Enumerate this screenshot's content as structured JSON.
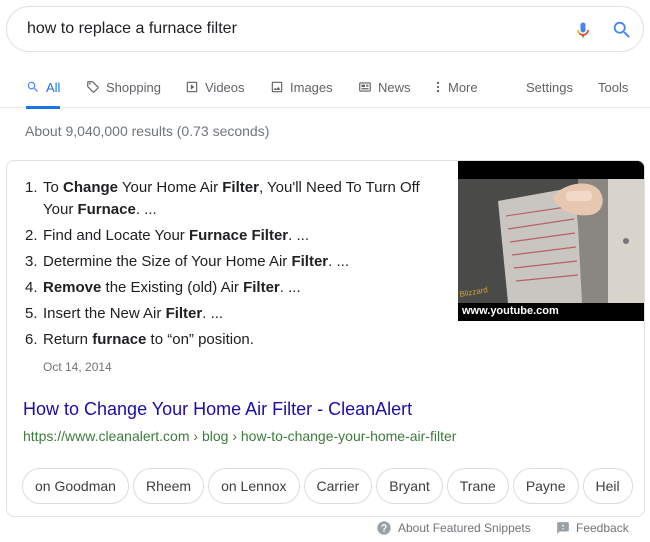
{
  "search": {
    "query": "how to replace a furnace filter"
  },
  "tabs": [
    {
      "label": "All",
      "active": true
    },
    {
      "label": "Shopping"
    },
    {
      "label": "Videos"
    },
    {
      "label": "Images"
    },
    {
      "label": "News"
    },
    {
      "label": "More"
    }
  ],
  "tools": {
    "settings": "Settings",
    "tools": "Tools"
  },
  "stats": "About 9,040,000 results (0.73 seconds)",
  "snippet": {
    "steps": [
      {
        "num": "1.",
        "parts": [
          "To ",
          "Change",
          " Your Home Air ",
          "Filter",
          ", You'll Need To Turn Off Your ",
          "Furnace",
          ". ..."
        ]
      },
      {
        "num": "2.",
        "parts": [
          "Find and Locate Your ",
          "Furnace Filter",
          ". ..."
        ]
      },
      {
        "num": "3.",
        "parts": [
          "Determine the Size of Your Home Air ",
          "Filter",
          ". ..."
        ]
      },
      {
        "num": "4.",
        "parts": [
          "",
          "Remove",
          " the Existing (old) Air ",
          "Filter",
          ". ..."
        ]
      },
      {
        "num": "5.",
        "parts": [
          "Insert the New Air ",
          "Filter",
          ". ..."
        ]
      },
      {
        "num": "6.",
        "parts": [
          "Return ",
          "furnace",
          " to “on” position."
        ]
      }
    ],
    "date": "Oct 14, 2014",
    "video_source": "www.youtube.com",
    "result_title": "How to Change Your Home Air Filter - CleanAlert",
    "result_url": {
      "domain": "https://www.cleanalert.com",
      "path1": "blog",
      "path2": "how-to-change-your-home-air-filter"
    },
    "chips": [
      "on Goodman",
      "Rheem",
      "on Lennox",
      "Carrier",
      "Bryant",
      "Trane",
      "Payne",
      "Heil"
    ]
  },
  "footer": {
    "about": "About Featured Snippets",
    "feedback": "Feedback"
  },
  "colors": {
    "accent": "#1a73e8",
    "link": "#1a0dab",
    "url_green": "#3c7b3c"
  }
}
